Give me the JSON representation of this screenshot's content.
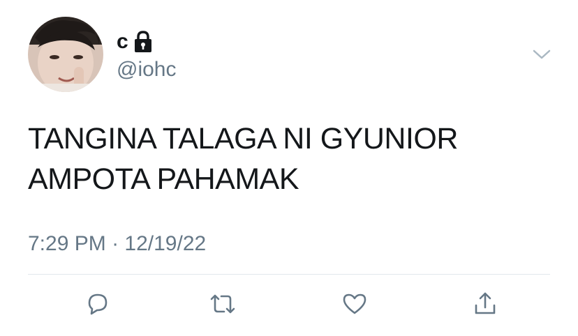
{
  "user": {
    "display_name": "c",
    "handle": "@iohc",
    "verified_lock": true,
    "lock_icon": "lock-icon",
    "avatar_icon": "avatar"
  },
  "tweet": {
    "line1": "TANGINA TALAGA NI GYUNIOR",
    "line2": "AMPOTA PAHAMAK",
    "time": "7:29 PM",
    "separator": "·",
    "date": "12/19/22"
  },
  "actions": [
    {
      "name": "reply",
      "icon": "comment-icon"
    },
    {
      "name": "retweet",
      "icon": "retweet-icon"
    },
    {
      "name": "like",
      "icon": "heart-icon"
    },
    {
      "name": "share",
      "icon": "share-icon"
    }
  ],
  "colors": {
    "text": "#14171a",
    "secondary": "#657786",
    "divider": "#e1e8ed",
    "icon": "#657786"
  }
}
